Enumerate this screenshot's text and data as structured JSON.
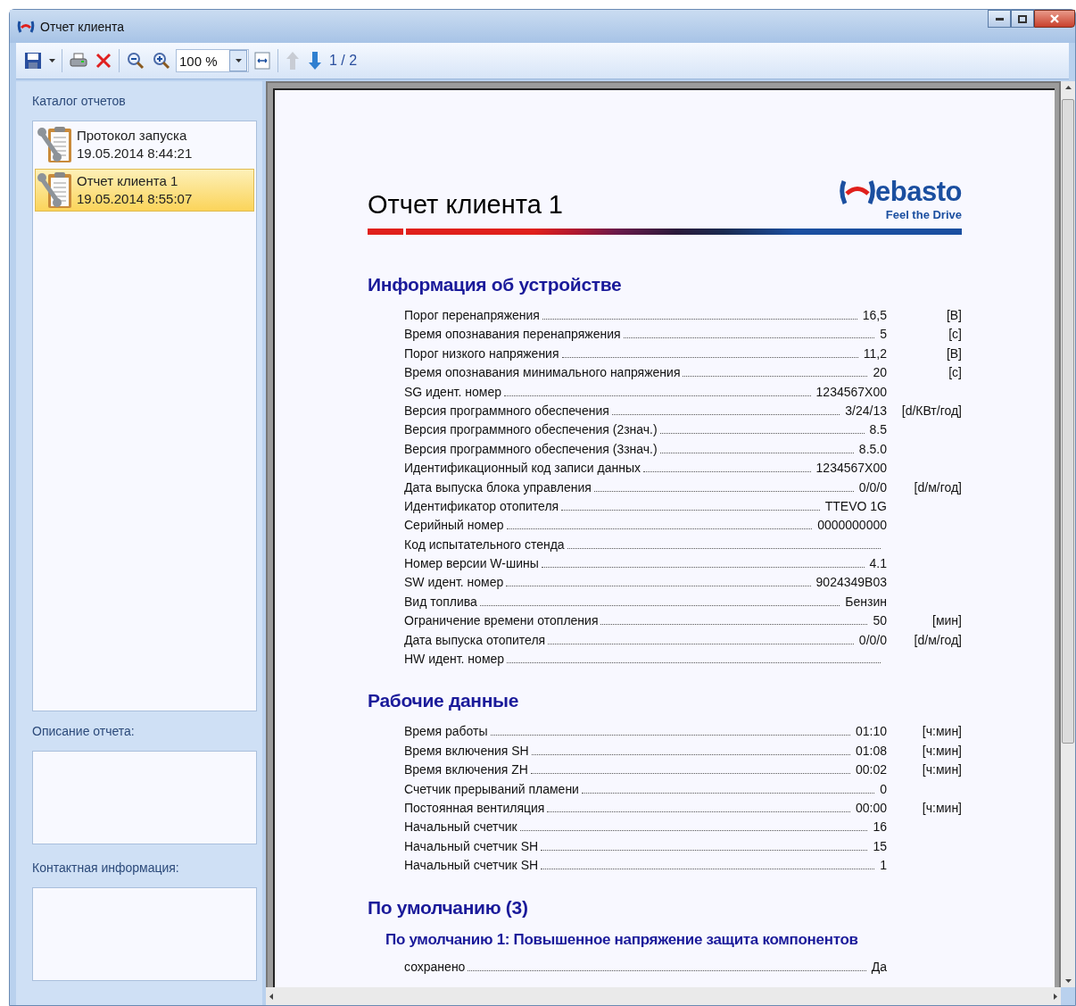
{
  "window": {
    "title": "Отчет клиента"
  },
  "toolbar": {
    "zoom": "100 %",
    "page": "1 / 2",
    "up_disabled": true
  },
  "catalog": {
    "title": "Каталог отчетов",
    "items": [
      {
        "name": "Протокол запуска",
        "date": "19.05.2014 8:44:21",
        "selected": false
      },
      {
        "name": "Отчет клиента 1",
        "date": "19.05.2014 8:55:07",
        "selected": true
      }
    ]
  },
  "description": {
    "label": "Описание отчета:"
  },
  "contact": {
    "label": "Контактная информация:"
  },
  "report": {
    "title": "Отчет клиента 1",
    "logo": {
      "name": "ebasto",
      "tagline": "Feel the Drive"
    },
    "sections": [
      {
        "kind": "section",
        "title": "Информация об устройстве",
        "rows": [
          {
            "label": "Порог перенапряжения",
            "value": "16,5",
            "unit": "[В]"
          },
          {
            "label": "Время опознавания перенапряжения",
            "value": "5",
            "unit": "[с]"
          },
          {
            "label": "Порог низкого напряжения",
            "value": "11,2",
            "unit": "[В]"
          },
          {
            "label": "Время опознавания минимального напряжения",
            "value": "20",
            "unit": "[с]"
          },
          {
            "label": "SG идент. номер",
            "value": "1234567X00"
          },
          {
            "label": "Версия программного обеспечения",
            "value": "3/24/13",
            "unit": "[d/КВт/год]"
          },
          {
            "label": "Версия программного обеспечения (2знач.)",
            "value": "8.5"
          },
          {
            "label": "Версия программного обеспечения (3знач.)",
            "value": "8.5.0"
          },
          {
            "label": "Идентификационный код записи данных",
            "value": "1234567X00"
          },
          {
            "label": "Дата выпуска блока управления",
            "value": "0/0/0",
            "unit": "[d/м/год]"
          },
          {
            "label": "Идентификатор отопителя",
            "value": "TTEVO 1G"
          },
          {
            "label": "Серийный номер",
            "value": "0000000000"
          },
          {
            "label": "Код испытательного стенда"
          },
          {
            "label": "Номер версии W-шины",
            "value": "4.1"
          },
          {
            "label": "SW идент. номер",
            "value": "9024349B03"
          },
          {
            "label": "Вид топлива",
            "value": "Бензин"
          },
          {
            "label": "Ограничение времени отопления",
            "value": "50",
            "unit": "[мин]"
          },
          {
            "label": "Дата выпуска отопителя",
            "value": "0/0/0",
            "unit": "[d/м/год]"
          },
          {
            "label": "HW идент. номер"
          }
        ]
      },
      {
        "kind": "section",
        "title": "Рабочие данные",
        "rows": [
          {
            "label": "Время работы",
            "value": "01:10",
            "unit": "[ч:мин]"
          },
          {
            "label": "Время включения SH",
            "value": "01:08",
            "unit": "[ч:мин]"
          },
          {
            "label": "Время включения ZH",
            "value": "00:02",
            "unit": "[ч:мин]"
          },
          {
            "label": "Счетчик прерываний пламени",
            "value": "0"
          },
          {
            "label": "Постоянная вентиляция",
            "value": "00:00",
            "unit": "[ч:мин]"
          },
          {
            "label": "Начальный счетчик",
            "value": "16"
          },
          {
            "label": "Начальный счетчик SH",
            "value": "15"
          },
          {
            "label": "Начальный счетчик SH",
            "value": "1"
          }
        ]
      },
      {
        "kind": "section",
        "title": "По умолчанию (3)"
      },
      {
        "kind": "subsection",
        "title": "По умолчанию 1: Повышенное напряжение защита компонентов",
        "rows": [
          {
            "label": "сохранено",
            "value": "Да"
          }
        ]
      }
    ]
  }
}
